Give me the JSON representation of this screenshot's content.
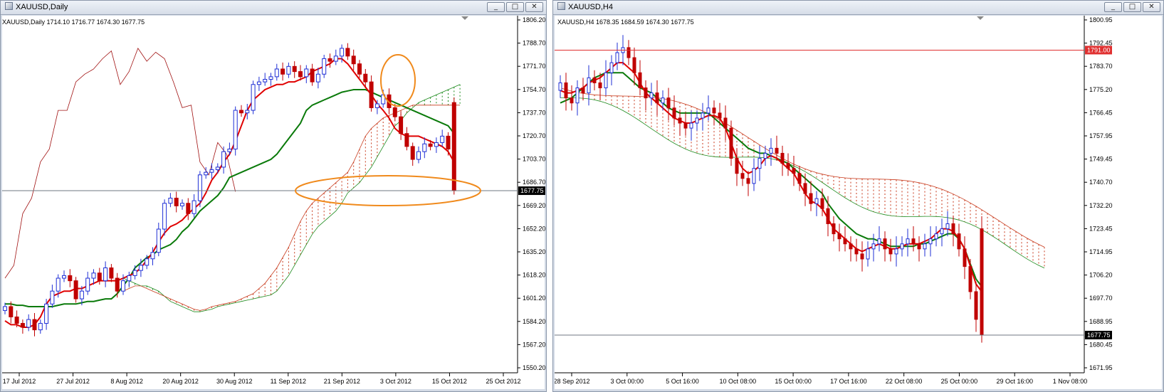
{
  "windows": [
    {
      "title": "XAUUSD,Daily",
      "info": "XAUUSD,Daily  1714.10 1716.77 1674.30 1677.75",
      "buttons": [
        "_",
        "□",
        "✕"
      ]
    },
    {
      "title": "XAUUSD,H4",
      "info": "XAUUSD,H4  1678.35 1684.59 1674.30 1677.75",
      "buttons": [
        "_",
        "□",
        "✕"
      ]
    }
  ],
  "colors": {
    "bull_candle": "#1f2fd6",
    "bear_candle": "#c00000",
    "tenkan": "#e00000",
    "kijun": "#0a7a0a",
    "chikou": "#a01010",
    "cloud_bull": "#1c8a1c",
    "cloud_bear": "#c83a1c",
    "annotation": "#f08a1c",
    "resistance": "#e03030",
    "price_line": "#6f7780",
    "price_badge": "#000000"
  },
  "chart_data": [
    {
      "type": "candlestick",
      "title": "XAUUSD,Daily",
      "ohlc_label": "1714.10 1716.77 1674.30 1677.75",
      "ylim": [
        1545,
        1810
      ],
      "y_ticks": [
        "1806.20",
        "1788.70",
        "1771.70",
        "1754.70",
        "1737.70",
        "1720.70",
        "1703.70",
        "1686.70",
        "1669.20",
        "1652.20",
        "1635.20",
        "1618.20",
        "1601.20",
        "1584.20",
        "1567.20",
        "1550.20"
      ],
      "x_ticks": [
        "17 Jul 2012",
        "27 Jul 2012",
        "8 Aug 2012",
        "20 Aug 2012",
        "30 Aug 2012",
        "11 Sep 2012",
        "21 Sep 2012",
        "3 Oct 2012",
        "15 Oct 2012",
        "25 Oct 2012"
      ],
      "current_price": "1677.75",
      "closes": [
        1588,
        1580,
        1575,
        1572,
        1578,
        1570,
        1575,
        1590,
        1600,
        1610,
        1612,
        1608,
        1594,
        1600,
        1610,
        1614,
        1608,
        1618,
        1610,
        1600,
        1608,
        1612,
        1616,
        1620,
        1625,
        1630,
        1648,
        1668,
        1672,
        1666,
        1668,
        1660,
        1670,
        1690,
        1692,
        1694,
        1696,
        1708,
        1710,
        1740,
        1738,
        1740,
        1760,
        1762,
        1764,
        1766,
        1772,
        1768,
        1774,
        1770,
        1766,
        1772,
        1762,
        1768,
        1780,
        1778,
        1782,
        1788,
        1782,
        1776,
        1768,
        1762,
        1742,
        1745,
        1752,
        1742,
        1735,
        1722,
        1712,
        1702,
        1708,
        1714,
        1712,
        1715,
        1720,
        1710,
        1677.75
      ],
      "tenkan": [
        1577,
        1574,
        1574,
        1572,
        1572,
        1574,
        1580,
        1590,
        1596,
        1598,
        1600,
        1600,
        1602,
        1602,
        1604,
        1606,
        1608,
        1608,
        1608,
        1608,
        1610,
        1612,
        1614,
        1618,
        1624,
        1630,
        1638,
        1645,
        1650,
        1652,
        1655,
        1660,
        1664,
        1668,
        1676,
        1686,
        1692,
        1700,
        1706,
        1716,
        1728,
        1740,
        1748,
        1752,
        1756,
        1758,
        1760,
        1760,
        1762,
        1762,
        1764,
        1766,
        1770,
        1772,
        1774,
        1776,
        1780,
        1780,
        1776,
        1770,
        1764,
        1758,
        1752,
        1745,
        1740,
        1734,
        1726,
        1722,
        1720,
        1720,
        1720,
        1718,
        1716,
        1714,
        1712,
        1708,
        1700
      ],
      "kijun": [
        1590,
        1590,
        1589,
        1589,
        1588,
        1588,
        1588,
        1588,
        1588,
        1589,
        1590,
        1590,
        1590,
        1591,
        1592,
        1592,
        1593,
        1594,
        1594,
        1598,
        1604,
        1610,
        1618,
        1622,
        1626,
        1628,
        1632,
        1634,
        1636,
        1640,
        1646,
        1650,
        1656,
        1662,
        1666,
        1670,
        1674,
        1680,
        1688,
        1690,
        1692,
        1694,
        1696,
        1698,
        1700,
        1702,
        1706,
        1712,
        1718,
        1724,
        1730,
        1740,
        1744,
        1746,
        1748,
        1750,
        1752,
        1754,
        1755,
        1756,
        1756,
        1756,
        1754,
        1752,
        1750,
        1748,
        1746,
        1744,
        1742,
        1740,
        1738,
        1736,
        1734,
        1732,
        1730,
        1728,
        1722
      ],
      "span_a": [
        1610,
        1608,
        1606,
        1604,
        1604,
        1602,
        1600,
        1596,
        1592,
        1590,
        1588,
        1586,
        1584,
        1584,
        1585,
        1586,
        1588,
        1589,
        1590,
        1591,
        1592,
        1593,
        1594,
        1595,
        1596,
        1597,
        1600,
        1606,
        1612,
        1620,
        1628,
        1636,
        1644,
        1650,
        1654,
        1658,
        1662,
        1668,
        1676,
        1680,
        1684,
        1690,
        1696,
        1704,
        1712,
        1720,
        1728,
        1732,
        1738,
        1742,
        1746,
        1748,
        1750,
        1752,
        1754,
        1756,
        1758,
        1760
      ],
      "span_b": [
        1600,
        1602,
        1604,
        1604,
        1602,
        1600,
        1598,
        1596,
        1594,
        1592,
        1590,
        1588,
        1586,
        1585,
        1586,
        1588,
        1589,
        1590,
        1591,
        1592,
        1594,
        1596,
        1598,
        1602,
        1606,
        1612,
        1618,
        1626,
        1634,
        1644,
        1654,
        1662,
        1668,
        1672,
        1676,
        1680,
        1684,
        1688,
        1692,
        1700,
        1710,
        1720,
        1726,
        1730,
        1734,
        1736,
        1738,
        1740,
        1742,
        1744,
        1744,
        1744,
        1744,
        1744,
        1744,
        1744,
        1744,
        1744
      ],
      "chikou": [
        1610,
        1620,
        1660,
        1672,
        1700,
        1710,
        1740,
        1740,
        1762,
        1768,
        1772,
        1780,
        1786,
        1760,
        1770,
        1788,
        1778,
        1785,
        1780,
        1762,
        1742,
        1744,
        1700,
        1690,
        1715,
        1706,
        1677
      ]
    },
    {
      "type": "candlestick",
      "title": "XAUUSD,H4",
      "ohlc_label": "1678.35 1684.59 1674.30 1677.75",
      "ylim": [
        1667,
        1803
      ],
      "y_ticks": [
        "1800.95",
        "1792.45",
        "1783.70",
        "1775.20",
        "1766.45",
        "1757.95",
        "1749.45",
        "1740.70",
        "1732.20",
        "1723.45",
        "1714.95",
        "1706.20",
        "1697.70",
        "1688.95",
        "1680.45",
        "1671.95"
      ],
      "x_ticks": [
        "28 Sep 2012",
        "3 Oct 00:00",
        "5 Oct 16:00",
        "10 Oct 08:00",
        "15 Oct 00:00",
        "17 Oct 16:00",
        "22 Oct 08:00",
        "25 Oct 00:00",
        "29 Oct 16:00",
        "1 Nov 08:00"
      ],
      "resistance": "1791.00",
      "current_price": "1677.75",
      "closes": [
        1778,
        1772,
        1770,
        1776,
        1774,
        1780,
        1778,
        1776,
        1782,
        1786,
        1790,
        1792,
        1788,
        1782,
        1776,
        1772,
        1774,
        1770,
        1772,
        1768,
        1764,
        1762,
        1760,
        1762,
        1764,
        1766,
        1768,
        1766,
        1764,
        1760,
        1748,
        1742,
        1740,
        1738,
        1744,
        1748,
        1750,
        1752,
        1750,
        1746,
        1744,
        1742,
        1738,
        1734,
        1730,
        1732,
        1728,
        1722,
        1718,
        1716,
        1714,
        1712,
        1710,
        1708,
        1712,
        1714,
        1716,
        1712,
        1710,
        1712,
        1714,
        1716,
        1714,
        1712,
        1714,
        1716,
        1718,
        1720,
        1722,
        1718,
        1712,
        1705,
        1695,
        1684,
        1677.75
      ],
      "tenkan": [
        1775,
        1774,
        1774,
        1775,
        1776,
        1778,
        1779,
        1780,
        1782,
        1784,
        1786,
        1786,
        1784,
        1782,
        1778,
        1774,
        1772,
        1770,
        1768,
        1766,
        1764,
        1763,
        1762,
        1762,
        1763,
        1764,
        1765,
        1765,
        1764,
        1760,
        1754,
        1748,
        1744,
        1742,
        1743,
        1745,
        1748,
        1749,
        1748,
        1746,
        1744,
        1742,
        1738,
        1734,
        1731,
        1730,
        1728,
        1724,
        1720,
        1718,
        1716,
        1714,
        1712,
        1711,
        1712,
        1713,
        1714,
        1713,
        1712,
        1712,
        1713,
        1714,
        1714,
        1714,
        1715,
        1716,
        1718,
        1720,
        1720,
        1719,
        1716,
        1712,
        1705,
        1698,
        1695
      ],
      "kijun": [
        1770,
        1771,
        1772,
        1774,
        1776,
        1778,
        1780,
        1781,
        1782,
        1782,
        1782,
        1782,
        1780,
        1778,
        1776,
        1775,
        1774,
        1772,
        1770,
        1768,
        1767,
        1766,
        1766,
        1766,
        1766,
        1766,
        1766,
        1764,
        1762,
        1760,
        1758,
        1756,
        1754,
        1752,
        1751,
        1750,
        1750,
        1749,
        1748,
        1747,
        1746,
        1744,
        1742,
        1740,
        1738,
        1736,
        1734,
        1730,
        1727,
        1724,
        1722,
        1720,
        1718,
        1717,
        1716,
        1716,
        1715,
        1714,
        1713,
        1713,
        1713,
        1713,
        1713,
        1714,
        1714,
        1715,
        1716,
        1717,
        1718,
        1718,
        1716,
        1712,
        1706,
        1700,
        1697
      ]
    }
  ]
}
